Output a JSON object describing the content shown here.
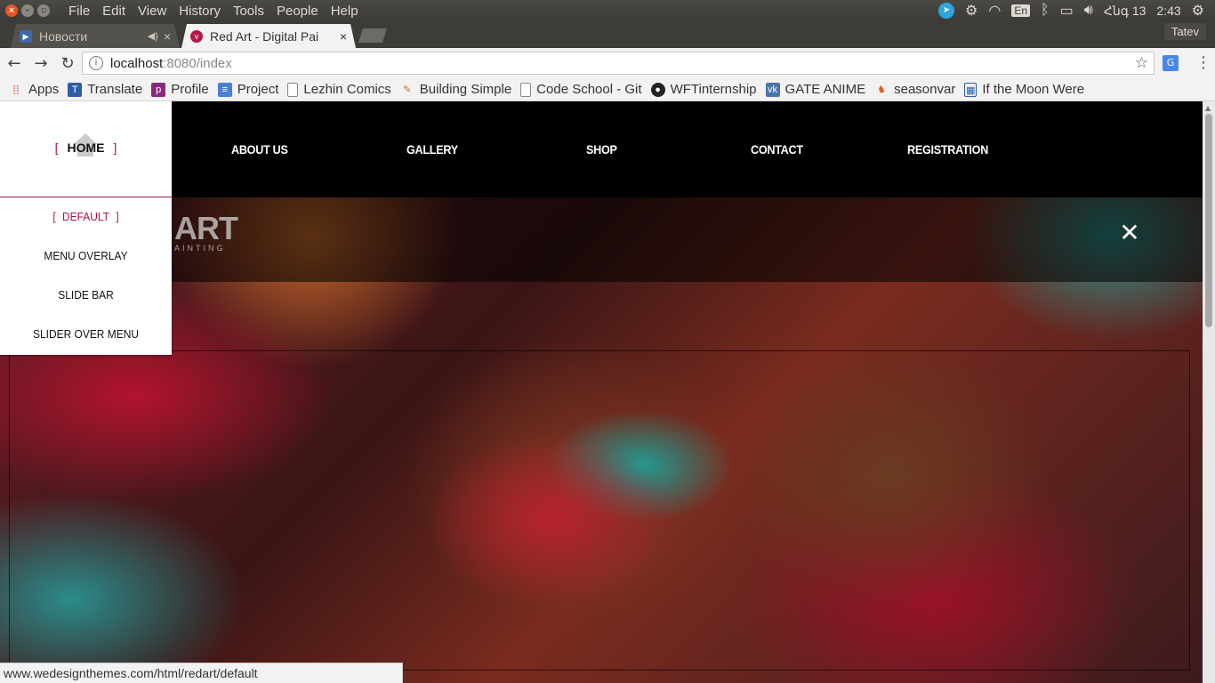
{
  "os": {
    "menu": [
      "File",
      "Edit",
      "View",
      "History",
      "Tools",
      "People",
      "Help"
    ],
    "language": "En",
    "date": "Հնգ 13",
    "time": "2:43"
  },
  "browser": {
    "tabs": [
      {
        "title": "Новости",
        "active": false
      },
      {
        "title": "Red Art - Digital Pai",
        "active": true
      }
    ],
    "profile_name": "Tatev",
    "url_host": "localhost",
    "url_rest": ":8080/index",
    "bookmarks": [
      {
        "label": "Apps",
        "icon": "apps-grid-icon"
      },
      {
        "label": "Translate",
        "icon": "translate-icon"
      },
      {
        "label": "Profile",
        "icon": "profile-p-icon"
      },
      {
        "label": "Project",
        "icon": "doc-icon"
      },
      {
        "label": "Lezhin Comics",
        "icon": "page-icon"
      },
      {
        "label": "Building Simple",
        "icon": "building-icon"
      },
      {
        "label": "Code School - Git",
        "icon": "page-icon"
      },
      {
        "label": "WFTinternship",
        "icon": "github-icon"
      },
      {
        "label": "GATE ANIME",
        "icon": "vk-icon"
      },
      {
        "label": "seasonvar",
        "icon": "seasonvar-icon"
      },
      {
        "label": "If the Moon Were",
        "icon": "grid-icon"
      }
    ],
    "status_url": "www.wedesignthemes.com/html/redart/default"
  },
  "site": {
    "nav": {
      "home": "HOME",
      "about": "ABOUT US",
      "gallery": "GALLERY",
      "shop": "SHOP",
      "contact": "CONTACT",
      "registration": "REGISTRATION"
    },
    "home_submenu": {
      "default": "DEFAULT",
      "menu_overlay": "MENU OVERLAY",
      "slide_bar": "SLIDE BAR",
      "slider_over_menu": "SLIDER OVER MENU"
    },
    "logo_text": "ART",
    "logo_sub": "AINTING",
    "accent_color": "#a1173f"
  }
}
